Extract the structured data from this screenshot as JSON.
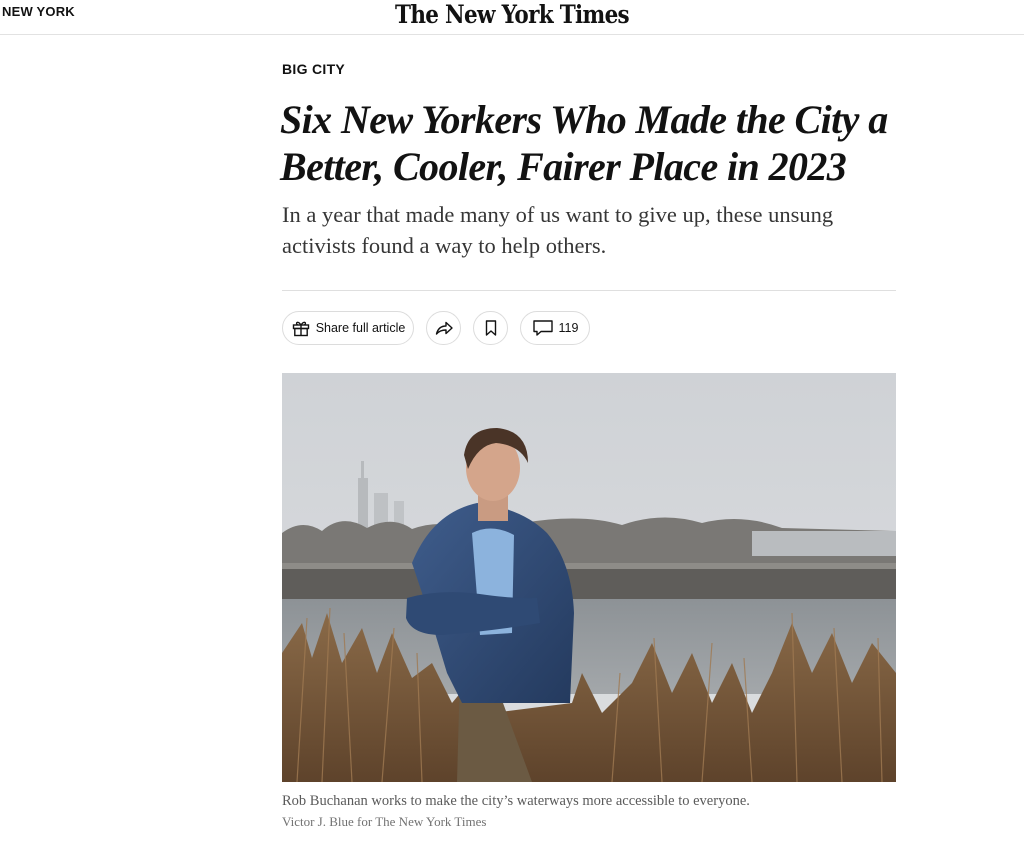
{
  "header": {
    "section": "NEW YORK",
    "logo": "The New York Times"
  },
  "article": {
    "kicker": "BIG CITY",
    "headline": "Six New Yorkers Who Made the City a Better, Cooler, Fairer Place in 2023",
    "summary": "In a year that made many of us want to give up, these unsung activists found a way to help others."
  },
  "toolbar": {
    "share_label": "Share full article",
    "comment_count": "119",
    "icons": {
      "share": "gift-icon",
      "forward": "share-arrow-icon",
      "save": "bookmark-icon",
      "comments": "comment-bubble-icon"
    }
  },
  "image": {
    "caption": "Rob Buchanan works to make the city’s waterways more accessible to everyone.",
    "credit": "Victor J. Blue for The New York Times"
  }
}
